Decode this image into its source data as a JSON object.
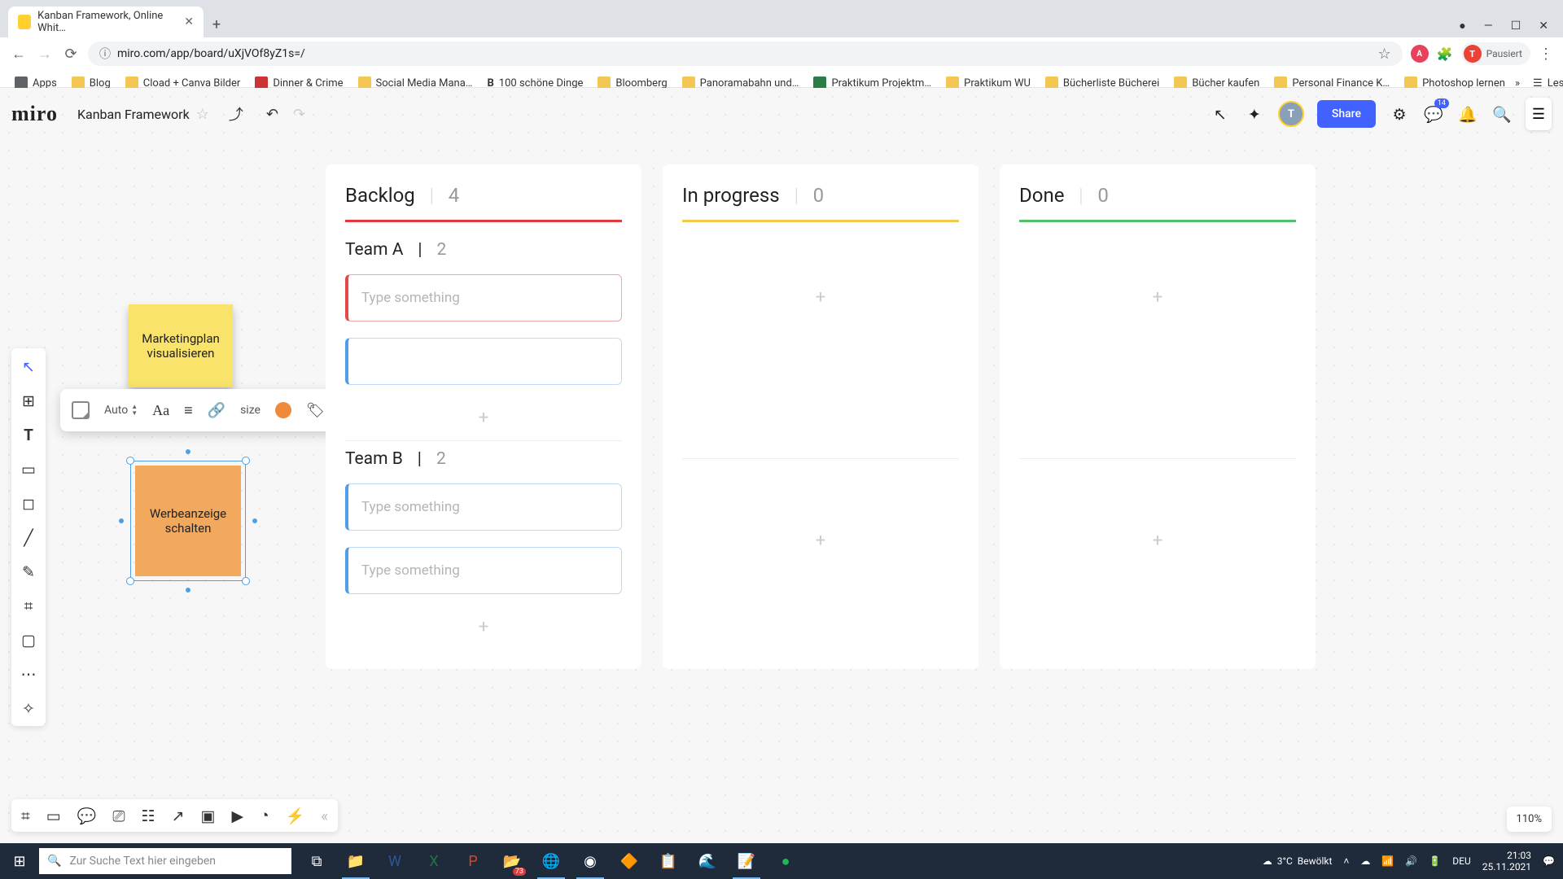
{
  "browser": {
    "tab_title": "Kanban Framework, Online Whit…",
    "url": "miro.com/app/board/uXjVOf8yZ1s=/",
    "profile_status": "Pausiert",
    "profile_initial": "T",
    "bookmarks": [
      "Apps",
      "Blog",
      "Cload + Canva Bilder",
      "Dinner & Crime",
      "Social Media Mana…",
      "100 schöne Dinge",
      "Bloomberg",
      "Panoramabahn und…",
      "Praktikum Projektm…",
      "Praktikum WU",
      "Bücherliste Bücherei",
      "Bücher kaufen",
      "Personal Finance K…",
      "Photoshop lernen"
    ],
    "reading_list": "Leseliste"
  },
  "miro": {
    "logo": "miro",
    "board_name": "Kanban Framework",
    "share": "Share",
    "notif_badge": "14",
    "zoom": "110%",
    "avatar_initial": "T"
  },
  "context_toolbar": {
    "auto": "Auto",
    "size_label": "size"
  },
  "stickies": {
    "yellow": "Marketingplan visualisieren",
    "orange": "Werbeanzeige schalten"
  },
  "kanban": {
    "cols": [
      {
        "title": "Backlog",
        "count": "4",
        "bar": "bar-red"
      },
      {
        "title": "In progress",
        "count": "0",
        "bar": "bar-yel"
      },
      {
        "title": "Done",
        "count": "0",
        "bar": "bar-grn"
      }
    ],
    "teams": [
      {
        "name": "Team A",
        "count": "2"
      },
      {
        "name": "Team B",
        "count": "2"
      }
    ],
    "placeholder": "Type something"
  },
  "taskbar": {
    "search_placeholder": "Zur Suche Text hier eingeben",
    "weather_temp": "3°C",
    "weather_desc": "Bewölkt",
    "lang": "DEU",
    "time": "21:03",
    "date": "25.11.2021",
    "explorer_badge": "73"
  }
}
